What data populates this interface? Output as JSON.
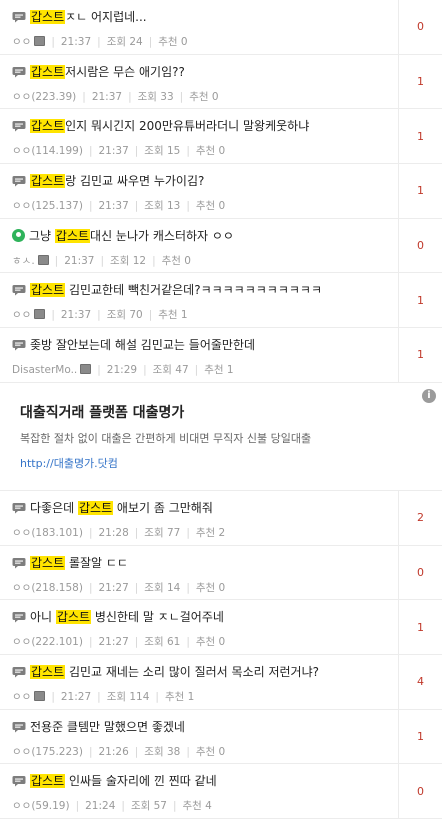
{
  "posts": [
    {
      "pre": "",
      "hl": "갑스트",
      "post": "ㅈㄴ 어지럽네...",
      "icon": "speech-bubble-icon",
      "author": "ㅇㅇ",
      "memo": true,
      "time": "21:37",
      "views": "조회 24",
      "rec": "추천 0",
      "comments": "0"
    },
    {
      "pre": "",
      "hl": "갑스트",
      "post": "저시람은 무슨 애기임??",
      "icon": "speech-bubble-icon",
      "author": "ㅇㅇ(223.39)",
      "memo": false,
      "time": "21:37",
      "views": "조회 33",
      "rec": "추천 0",
      "comments": "1"
    },
    {
      "pre": "",
      "hl": "갑스트",
      "post": "인지 뭐시긴지 200만유튜버라더니 말왕케웃하냐",
      "icon": "speech-bubble-icon",
      "author": "ㅇㅇ(114.199)",
      "memo": false,
      "time": "21:37",
      "views": "조회 15",
      "rec": "추천 0",
      "comments": "1"
    },
    {
      "pre": "",
      "hl": "갑스트",
      "post": "랑 김민교 싸우면 누가이김?",
      "icon": "speech-bubble-icon",
      "author": "ㅇㅇ(125.137)",
      "memo": false,
      "time": "21:37",
      "views": "조회 13",
      "rec": "추천 0",
      "comments": "1"
    },
    {
      "pre": "그냥 ",
      "hl": "갑스트",
      "post": "대신 눈나가 캐스터하자 ㅇㅇ",
      "icon": "green-user-icon",
      "author": "ㅎㅅ.",
      "memo": true,
      "time": "21:37",
      "views": "조회 12",
      "rec": "추천 0",
      "comments": "0"
    },
    {
      "pre": "",
      "hl": "갑스트",
      "post": " 김민교한테 빽친거같은데?ㅋㅋㅋㅋㅋㅋㅋㅋㅋㅋㅋ",
      "icon": "speech-bubble-icon",
      "author": "ㅇㅇ",
      "memo": true,
      "time": "21:37",
      "views": "조회 70",
      "rec": "추천 1",
      "comments": "1"
    },
    {
      "pre": "좆방 잘안보는데 해설 김민교는 들어줄만한데",
      "hl": "",
      "post": "",
      "icon": "speech-bubble-icon",
      "author": "DisasterMo..",
      "memo": true,
      "time": "21:29",
      "views": "조회 47",
      "rec": "추천 1",
      "comments": "1"
    }
  ],
  "ad": {
    "heading": "대출직거래 플랫폼 대출명가",
    "desc": "복잡한 절차 없이 대출은 간편하게 비대면 무직자 신불 당일대출",
    "url": "http://대출명가.닷컴",
    "info_label": "i"
  },
  "posts2": [
    {
      "pre": "다좋은데 ",
      "hl": "갑스트",
      "post": " 애보기 좀 그만해줘",
      "icon": "speech-bubble-icon",
      "author": "ㅇㅇ(183.101)",
      "memo": false,
      "time": "21:28",
      "views": "조회 77",
      "rec": "추천 2",
      "comments": "2"
    },
    {
      "pre": "",
      "hl": "갑스트",
      "post": " 롤잘알 ㄷㄷ",
      "icon": "speech-bubble-icon",
      "author": "ㅇㅇ(218.158)",
      "memo": false,
      "time": "21:27",
      "views": "조회 14",
      "rec": "추천 0",
      "comments": "0"
    },
    {
      "pre": "아니 ",
      "hl": "갑스트",
      "post": " 병신한테 말 ㅈㄴ걸어주네",
      "icon": "speech-bubble-icon",
      "author": "ㅇㅇ(222.101)",
      "memo": false,
      "time": "21:27",
      "views": "조회 61",
      "rec": "추천 0",
      "comments": "1"
    },
    {
      "pre": "",
      "hl": "갑스트",
      "post": " 김민교 재네는 소리 많이 질러서 목소리 저런거냐?",
      "icon": "speech-bubble-icon",
      "author": "ㅇㅇ",
      "memo": true,
      "time": "21:27",
      "views": "조회 114",
      "rec": "추천 1",
      "comments": "4"
    },
    {
      "pre": "전용준 클템만 말했으면 좋겠네",
      "hl": "",
      "post": "",
      "icon": "speech-bubble-icon",
      "author": "ㅇㅇ(175.223)",
      "memo": false,
      "time": "21:26",
      "views": "조회 38",
      "rec": "추천 0",
      "comments": "1"
    },
    {
      "pre": "",
      "hl": "갑스트",
      "post": " 인싸들 술자리에 낀 찐따 같네",
      "icon": "speech-bubble-icon",
      "author": "ㅇㅇ(59.19)",
      "memo": false,
      "time": "21:24",
      "views": "조회 57",
      "rec": "추천 4",
      "comments": "0"
    }
  ]
}
